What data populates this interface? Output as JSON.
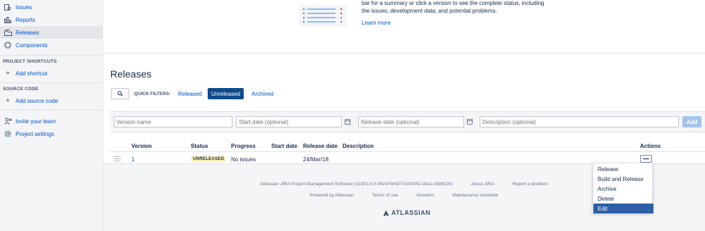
{
  "sidebar": {
    "items": [
      {
        "label": "Issues",
        "icon": "issues-icon"
      },
      {
        "label": "Reports",
        "icon": "reports-icon"
      },
      {
        "label": "Releases",
        "icon": "releases-icon"
      },
      {
        "label": "Components",
        "icon": "components-icon"
      }
    ],
    "project_shortcuts_heading": "PROJECT SHORTCUTS",
    "add_shortcut": "Add shortcut",
    "source_code_heading": "SOURCE CODE",
    "add_source_code": "Add source code",
    "invite_team": "Invite your team",
    "project_settings": "Project settings"
  },
  "banner": {
    "text": "bar for a summary or click a version to see the complete status, including the issues, development data, and potential problems.",
    "learn_more": "Learn more"
  },
  "page": {
    "title": "Releases"
  },
  "filters": {
    "label": "QUICK FILTERS:",
    "items": [
      "Released",
      "Unreleased",
      "Archived"
    ],
    "active": "Unreleased"
  },
  "add_form": {
    "version_placeholder": "Version name",
    "start_placeholder": "Start date (optional)",
    "release_placeholder": "Release date (optional)",
    "description_placeholder": "Description (optional)",
    "add_label": "Add"
  },
  "table": {
    "headers": {
      "version": "Version",
      "status": "Status",
      "progress": "Progress",
      "start_date": "Start date",
      "release_date": "Release date",
      "description": "Description",
      "actions": "Actions"
    },
    "rows": [
      {
        "version": "1",
        "status": "UNRELEASED",
        "progress": "No issues",
        "start_date": "",
        "release_date": "24/Mar/18",
        "description": "",
        "actions": "•••"
      }
    ]
  },
  "actions_menu": {
    "items": [
      "Release",
      "Build and Release",
      "Archive",
      "Delete",
      "Edit"
    ],
    "highlighted": "Edit"
  },
  "footer": {
    "software": "Atlassian JIRA Project Management Software (v1001.0.0-SNAPSHOT#100082-sha1:d388130)",
    "about": "About JIRA",
    "report": "Report a problem",
    "powered": "Powered by Atlassian",
    "terms": "Terms of use",
    "answers": "Answers",
    "maintenance": "Maintenance schedule",
    "separator": "·",
    "logo_text": "ATLASSIAN"
  },
  "colors": {
    "link": "#0052cc",
    "active_filter": "#0e4a8c",
    "lozenge": "#fff0b3",
    "menu_highlight": "#2c5ea8"
  }
}
